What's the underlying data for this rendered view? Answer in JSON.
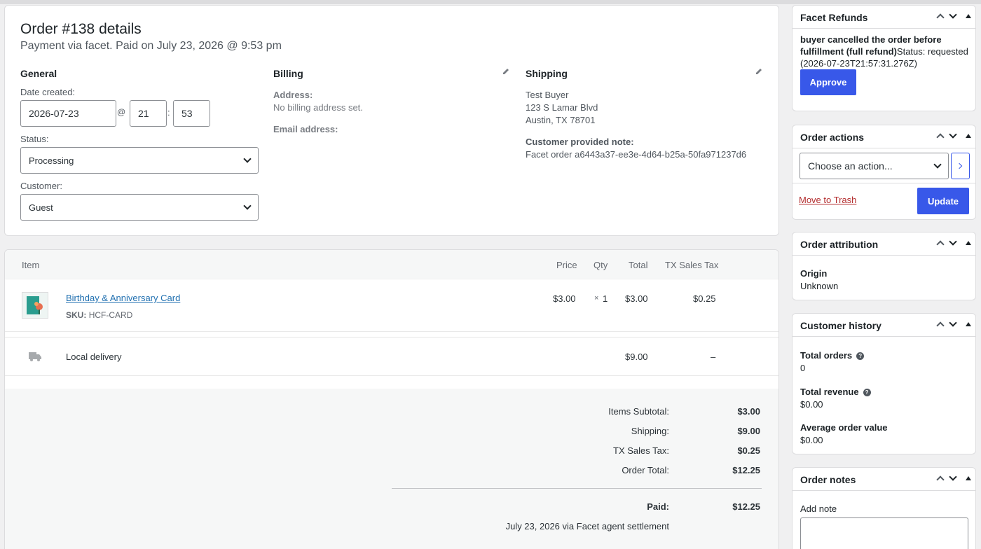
{
  "order": {
    "title": "Order #138 details",
    "subtitle": "Payment via facet. Paid on July 23, 2026 @ 9:53 pm"
  },
  "general": {
    "heading": "General",
    "date_label": "Date created:",
    "date_value": "2026-07-23",
    "at": "@",
    "hour": "21",
    "colon": ":",
    "minute": "53",
    "status_label": "Status:",
    "status_value": "Processing",
    "customer_label": "Customer:",
    "customer_value": "Guest"
  },
  "billing": {
    "heading": "Billing",
    "address_label": "Address:",
    "address_value": "No billing address set.",
    "email_label": "Email address:"
  },
  "shipping": {
    "heading": "Shipping",
    "name": "Test Buyer",
    "street": "123 S Lamar Blvd",
    "city": "Austin, TX 78701",
    "note_label": "Customer provided note:",
    "note_value": "Facet order a6443a37-ee3e-4d64-b25a-50fa971237d6"
  },
  "items": {
    "headers": {
      "item": "Item",
      "price": "Price",
      "qty": "Qty",
      "total": "Total",
      "tax": "TX Sales Tax"
    },
    "product": {
      "name": "Birthday & Anniversary Card",
      "sku_label": "SKU:",
      "sku": "HCF-CARD",
      "price": "$3.00",
      "qty_x": "×",
      "qty": "1",
      "total": "$3.00",
      "tax": "$0.25"
    },
    "shipping_line": {
      "name": "Local delivery",
      "total": "$9.00",
      "tax": "–"
    }
  },
  "totals": {
    "subtotal_label": "Items Subtotal:",
    "subtotal": "$3.00",
    "shipping_label": "Shipping:",
    "shipping": "$9.00",
    "tax_label": "TX Sales Tax:",
    "tax": "$0.25",
    "order_total_label": "Order Total:",
    "order_total": "$12.25",
    "paid_label": "Paid:",
    "paid": "$12.25",
    "paid_note": "July 23, 2026 via Facet agent settlement"
  },
  "refunds": {
    "title": "Facet Refunds",
    "reason_line1": "buyer cancelled the order before",
    "reason_line2": "fulfillment (full refund)",
    "status_text": "Status: requested",
    "timestamp": "(2026-07-23T21:57:31.276Z)",
    "approve": "Approve"
  },
  "actions": {
    "title": "Order actions",
    "select": "Choose an action...",
    "trash": "Move to Trash",
    "update": "Update"
  },
  "attribution": {
    "title": "Order attribution",
    "origin_label": "Origin",
    "origin_value": "Unknown"
  },
  "history": {
    "title": "Customer history",
    "orders_label": "Total orders",
    "orders_value": "0",
    "revenue_label": "Total revenue",
    "revenue_value": "$0.00",
    "aov_label": "Average order value",
    "aov_value": "$0.00"
  },
  "notes": {
    "title": "Order notes",
    "add_label": "Add note"
  },
  "colors": {
    "accent": "#3858e9",
    "link": "#2271b1",
    "danger": "#b32d2e"
  }
}
